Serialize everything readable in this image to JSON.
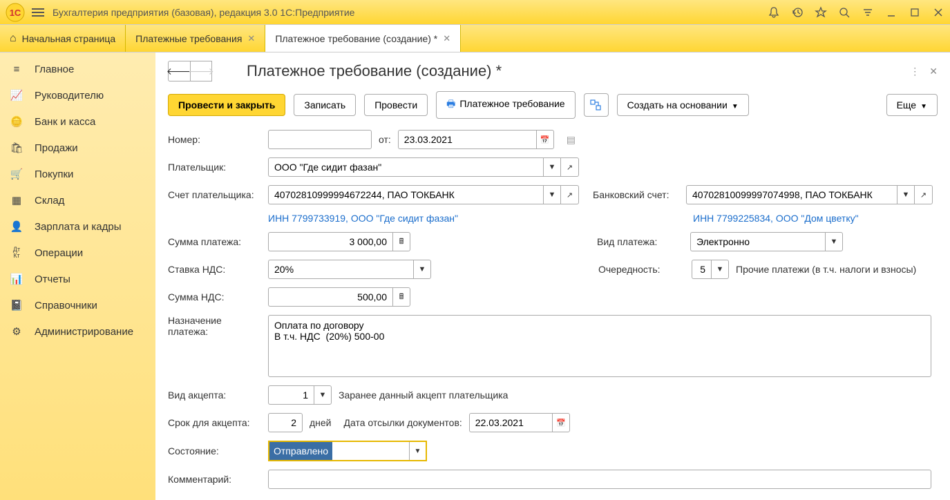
{
  "titlebar": {
    "title": "Бухгалтерия предприятия (базовая), редакция 3.0 1С:Предприятие"
  },
  "tabs": {
    "home": "Начальная страница",
    "t1": "Платежные требования",
    "t2": "Платежное требование (создание) *"
  },
  "sidebar": {
    "items": [
      "Главное",
      "Руководителю",
      "Банк и касса",
      "Продажи",
      "Покупки",
      "Склад",
      "Зарплата и кадры",
      "Операции",
      "Отчеты",
      "Справочники",
      "Администрирование"
    ]
  },
  "content": {
    "title": "Платежное требование (создание) *"
  },
  "toolbar": {
    "post_close": "Провести и закрыть",
    "save": "Записать",
    "post": "Провести",
    "print": "Платежное требование",
    "based_on": "Создать на основании",
    "more": "Еще"
  },
  "form": {
    "number_lbl": "Номер:",
    "ot_lbl": "от:",
    "date": "23.03.2021",
    "payer_lbl": "Плательщик:",
    "payer_val": "ООО \"Где сидит фазан\"",
    "payer_acc_lbl": "Счет плательщика:",
    "payer_acc_val": "40702810999994672244, ПАО ТОКБАНК",
    "bank_acc_lbl": "Банковский счет:",
    "bank_acc_val": "40702810099997074998, ПАО ТОКБАНК",
    "payer_inn": "ИНН 7799733919, ООО \"Где сидит фазан\"",
    "own_inn": "ИНН 7799225834, ООО \"Дом цветку\"",
    "sum_lbl": "Сумма платежа:",
    "sum_val": "3 000,00",
    "pay_type_lbl": "Вид платежа:",
    "pay_type_val": "Электронно",
    "vat_rate_lbl": "Ставка НДС:",
    "vat_rate_val": "20%",
    "priority_lbl": "Очередность:",
    "priority_val": "5",
    "priority_desc": "Прочие платежи (в т.ч. налоги и взносы)",
    "vat_sum_lbl": "Сумма НДС:",
    "vat_sum_val": "500,00",
    "purpose_lbl": "Назначение платежа:",
    "purpose_val": "Оплата по договору\nВ т.ч. НДС  (20%) 500-00",
    "accept_type_lbl": "Вид акцепта:",
    "accept_type_val": "1",
    "accept_desc": "Заранее данный акцепт плательщика",
    "accept_term_lbl": "Срок для акцепта:",
    "accept_term_val": "2",
    "days_lbl": "дней",
    "send_date_lbl": "Дата отсылки документов:",
    "send_date_val": "22.03.2021",
    "state_lbl": "Состояние:",
    "state_val": "Отправлено",
    "comment_lbl": "Комментарий:"
  }
}
